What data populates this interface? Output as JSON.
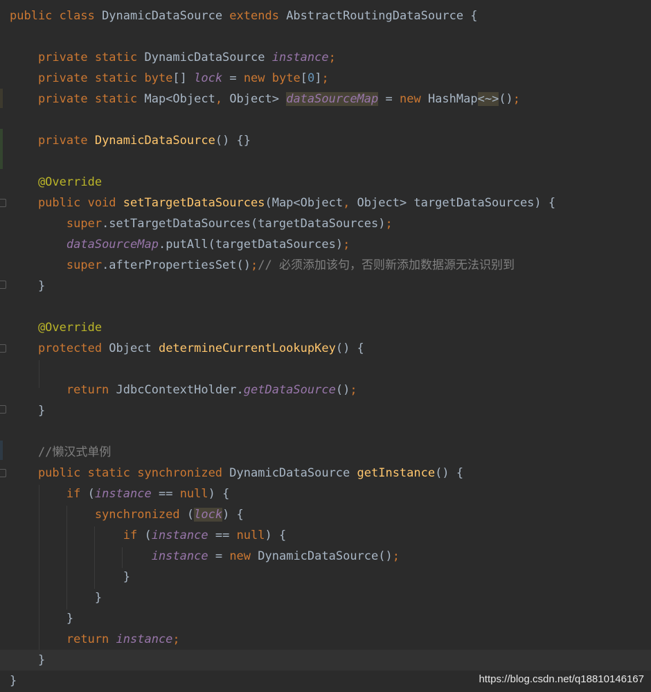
{
  "editor": {
    "language": "java",
    "theme": "darcula",
    "lines": [
      {
        "tokens": [
          {
            "t": "public class ",
            "c": "kw"
          },
          {
            "t": "DynamicDataSource ",
            "c": "ty"
          },
          {
            "t": "extends ",
            "c": "kw"
          },
          {
            "t": "AbstractRoutingDataSource {",
            "c": "ty"
          }
        ]
      },
      {
        "tokens": []
      },
      {
        "tokens": [
          {
            "t": "    private static ",
            "c": "kw"
          },
          {
            "t": "DynamicDataSource ",
            "c": "ty"
          },
          {
            "t": "instance",
            "c": "fd"
          },
          {
            "t": ";",
            "c": "kw"
          }
        ]
      },
      {
        "tokens": [
          {
            "t": "    private static ",
            "c": "kw"
          },
          {
            "t": "byte",
            "c": "kw"
          },
          {
            "t": "[] ",
            "c": "pl"
          },
          {
            "t": "lock",
            "c": "fd"
          },
          {
            "t": " = ",
            "c": "pl"
          },
          {
            "t": "new ",
            "c": "kw"
          },
          {
            "t": "byte",
            "c": "kw"
          },
          {
            "t": "[",
            "c": "pl"
          },
          {
            "t": "0",
            "c": "nm"
          },
          {
            "t": "]",
            "c": "pl"
          },
          {
            "t": ";",
            "c": "kw"
          }
        ]
      },
      {
        "tokens": [
          {
            "t": "    private static ",
            "c": "kw"
          },
          {
            "t": "Map<Object",
            "c": "ty"
          },
          {
            "t": ", ",
            "c": "kw"
          },
          {
            "t": "Object> ",
            "c": "ty"
          },
          {
            "t": "dataSourceMap",
            "c": "fd hl"
          },
          {
            "t": " = ",
            "c": "pl"
          },
          {
            "t": "new ",
            "c": "kw"
          },
          {
            "t": "HashMap",
            "c": "ty"
          },
          {
            "t": "<~>",
            "c": "pl hl"
          },
          {
            "t": "()",
            "c": "pl"
          },
          {
            "t": ";",
            "c": "kw"
          }
        ]
      },
      {
        "tokens": []
      },
      {
        "tokens": [
          {
            "t": "    private ",
            "c": "kw"
          },
          {
            "t": "DynamicDataSource",
            "c": "fn"
          },
          {
            "t": "() {}",
            "c": "pl"
          }
        ]
      },
      {
        "tokens": []
      },
      {
        "tokens": [
          {
            "t": "    @Override",
            "c": "an"
          }
        ]
      },
      {
        "tokens": [
          {
            "t": "    public void ",
            "c": "kw"
          },
          {
            "t": "setTargetDataSources",
            "c": "fn"
          },
          {
            "t": "(Map<Object",
            "c": "pl"
          },
          {
            "t": ", ",
            "c": "kw"
          },
          {
            "t": "Object> targetDataSources) {",
            "c": "pl"
          }
        ]
      },
      {
        "tokens": [
          {
            "t": "        super",
            "c": "kw"
          },
          {
            "t": ".setTargetDataSources(targetDataSources)",
            "c": "pl"
          },
          {
            "t": ";",
            "c": "kw"
          }
        ]
      },
      {
        "tokens": [
          {
            "t": "        ",
            "c": "pl"
          },
          {
            "t": "dataSourceMap",
            "c": "fd"
          },
          {
            "t": ".putAll(targetDataSources)",
            "c": "pl"
          },
          {
            "t": ";",
            "c": "kw"
          }
        ]
      },
      {
        "tokens": [
          {
            "t": "        super",
            "c": "kw"
          },
          {
            "t": ".afterPropertiesSet()",
            "c": "pl"
          },
          {
            "t": ";",
            "c": "kw"
          },
          {
            "t": "// 必须添加该句，否则新添加数据源无法识别到",
            "c": "cm"
          }
        ]
      },
      {
        "tokens": [
          {
            "t": "    }",
            "c": "pl"
          }
        ]
      },
      {
        "tokens": []
      },
      {
        "tokens": [
          {
            "t": "    @Override",
            "c": "an"
          }
        ]
      },
      {
        "tokens": [
          {
            "t": "    protected ",
            "c": "kw"
          },
          {
            "t": "Object ",
            "c": "ty"
          },
          {
            "t": "determineCurrentLookupKey",
            "c": "fn"
          },
          {
            "t": "() {",
            "c": "pl"
          }
        ]
      },
      {
        "tokens": []
      },
      {
        "tokens": [
          {
            "t": "        return ",
            "c": "kw"
          },
          {
            "t": "JdbcContextHolder.",
            "c": "ty"
          },
          {
            "t": "getDataSource",
            "c": "fd"
          },
          {
            "t": "()",
            "c": "pl"
          },
          {
            "t": ";",
            "c": "kw"
          }
        ]
      },
      {
        "tokens": [
          {
            "t": "    }",
            "c": "pl"
          }
        ]
      },
      {
        "tokens": []
      },
      {
        "tokens": [
          {
            "t": "    //懒汉式单例",
            "c": "cm"
          }
        ]
      },
      {
        "tokens": [
          {
            "t": "    public static synchronized ",
            "c": "kw"
          },
          {
            "t": "DynamicDataSource ",
            "c": "ty"
          },
          {
            "t": "getInstance",
            "c": "fn"
          },
          {
            "t": "() {",
            "c": "pl"
          }
        ]
      },
      {
        "tokens": [
          {
            "t": "        if ",
            "c": "kw"
          },
          {
            "t": "(",
            "c": "pl"
          },
          {
            "t": "instance",
            "c": "fd"
          },
          {
            "t": " == ",
            "c": "pl"
          },
          {
            "t": "null",
            "c": "kw"
          },
          {
            "t": ") {",
            "c": "pl"
          }
        ]
      },
      {
        "tokens": [
          {
            "t": "            synchronized ",
            "c": "kw"
          },
          {
            "t": "(",
            "c": "pl"
          },
          {
            "t": "lock",
            "c": "fd hl"
          },
          {
            "t": ") {",
            "c": "pl"
          }
        ]
      },
      {
        "tokens": [
          {
            "t": "                if ",
            "c": "kw"
          },
          {
            "t": "(",
            "c": "pl"
          },
          {
            "t": "instance",
            "c": "fd"
          },
          {
            "t": " == ",
            "c": "pl"
          },
          {
            "t": "null",
            "c": "kw"
          },
          {
            "t": ") {",
            "c": "pl"
          }
        ]
      },
      {
        "tokens": [
          {
            "t": "                    ",
            "c": "pl"
          },
          {
            "t": "instance",
            "c": "fd"
          },
          {
            "t": " = ",
            "c": "pl"
          },
          {
            "t": "new ",
            "c": "kw"
          },
          {
            "t": "DynamicDataSource()",
            "c": "ty"
          },
          {
            "t": ";",
            "c": "kw"
          }
        ]
      },
      {
        "tokens": [
          {
            "t": "                }",
            "c": "pl"
          }
        ]
      },
      {
        "tokens": [
          {
            "t": "            }",
            "c": "pl"
          }
        ]
      },
      {
        "tokens": [
          {
            "t": "        }",
            "c": "pl"
          }
        ]
      },
      {
        "tokens": [
          {
            "t": "        return ",
            "c": "kw"
          },
          {
            "t": "instance",
            "c": "fd"
          },
          {
            "t": ";",
            "c": "kw"
          }
        ]
      },
      {
        "tokens": [
          {
            "t": "    }",
            "c": "pl"
          }
        ]
      },
      {
        "tokens": [
          {
            "t": "}",
            "c": "pl"
          }
        ]
      }
    ]
  },
  "watermark": "https://blog.csdn.net/q18810146167",
  "colors": {
    "background": "#2b2b2b",
    "keyword": "#cc7832",
    "field": "#9876aa",
    "method": "#ffc66d",
    "annotation": "#bbb529",
    "number": "#6897bb",
    "comment": "#808080",
    "text": "#a9b7c6"
  }
}
